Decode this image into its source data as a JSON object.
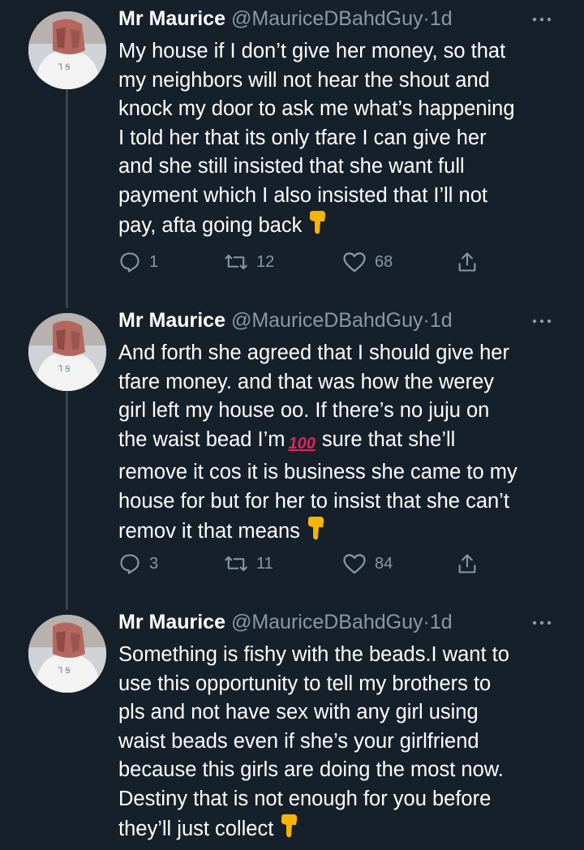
{
  "colors": {
    "background": "#15202b",
    "secondary_text": "#8899a6",
    "thread_line": "#38444d"
  },
  "tweets": [
    {
      "name": "Mr Maurice",
      "handle": "@MauriceDBahdGuy",
      "dot": "·",
      "time": "1d",
      "lines": [
        "My house if I don’t give her money, so that",
        "my neighbors will not hear the shout and",
        "knock my door to ask me what’s happening",
        "I told her that its only tfare I can give her",
        "and she still insisted that she want full",
        "payment which I also insisted that I’ll not",
        "pay, afta going back"
      ],
      "end_emoji": "pointing-down-emoji",
      "replies": "1",
      "retweets": "12",
      "likes": "68"
    },
    {
      "name": "Mr Maurice",
      "handle": "@MauriceDBahdGuy",
      "dot": "·",
      "time": "1d",
      "lines": [
        "And forth she agreed that I should give her",
        "tfare money. and that was how the werey",
        "girl left my house oo. If there’s no juju on",
        "the waist bead I’m",
        "sure that she’ll",
        "remove it cos it is business she came to my",
        "house for but for her to insist that she can’t",
        "remov it that means"
      ],
      "hundred_emoji": "100",
      "end_emoji": "pointing-down-emoji",
      "replies": "3",
      "retweets": "11",
      "likes": "84"
    },
    {
      "name": "Mr Maurice",
      "handle": "@MauriceDBahdGuy",
      "dot": "·",
      "time": "1d",
      "lines": [
        "Something is fishy with the beads.I want to",
        "use this opportunity to tell my brothers to",
        "pls and not have sex with any girl using",
        "waist beads even if she’s your girlfriend",
        "because this girls are doing the most now.",
        "Destiny that is not enough for you before",
        "they’ll just collect"
      ],
      "end_emoji": "pointing-down-emoji"
    }
  ]
}
